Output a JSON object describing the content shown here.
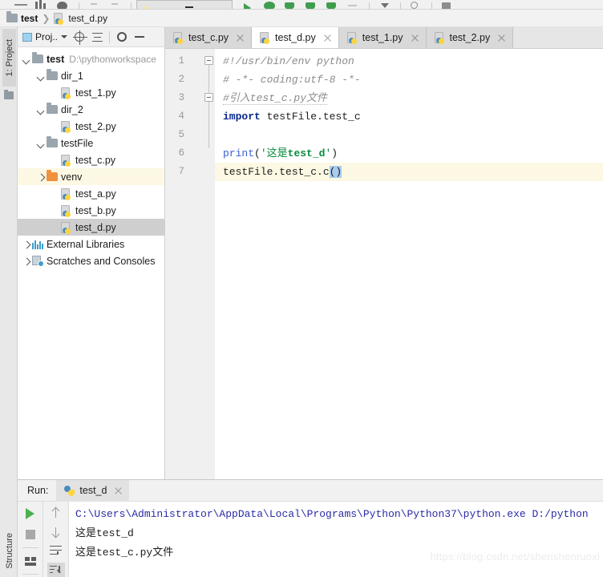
{
  "window": {
    "breadcrumb": {
      "project": "test",
      "file": "test_d.py"
    }
  },
  "toolbar": {
    "run_config": "",
    "icons": [
      "menu-icon",
      "chart-icon",
      "globe-icon",
      "back-icon",
      "forward-icon",
      "run-config-box",
      "run-icon",
      "debug-icon",
      "coverage-icon",
      "profile-icon",
      "attach-icon",
      "stop-icon",
      "dropdown-icon",
      "search-icon",
      "save-icon"
    ]
  },
  "left_strip": {
    "project_tab": "1: Project",
    "structure_tab": "Structure"
  },
  "project_panel": {
    "title": "Proj..",
    "buttons": [
      "locate-icon",
      "collapse-all-icon",
      "settings-icon",
      "hide-icon"
    ],
    "tree": [
      {
        "indent": 0,
        "arrow": "down",
        "icon": "folder",
        "label": "test",
        "bold": true,
        "path": "D:\\pythonworkspace",
        "state": ""
      },
      {
        "indent": 1,
        "arrow": "down",
        "icon": "folder",
        "label": "dir_1",
        "bold": false,
        "path": "",
        "state": ""
      },
      {
        "indent": 2,
        "arrow": "none",
        "icon": "python",
        "label": "test_1.py",
        "bold": false,
        "path": "",
        "state": ""
      },
      {
        "indent": 1,
        "arrow": "down",
        "icon": "folder",
        "label": "dir_2",
        "bold": false,
        "path": "",
        "state": ""
      },
      {
        "indent": 2,
        "arrow": "none",
        "icon": "python",
        "label": "test_2.py",
        "bold": false,
        "path": "",
        "state": ""
      },
      {
        "indent": 1,
        "arrow": "down",
        "icon": "folder",
        "label": "testFile",
        "bold": false,
        "path": "",
        "state": ""
      },
      {
        "indent": 2,
        "arrow": "none",
        "icon": "python",
        "label": "test_c.py",
        "bold": false,
        "path": "",
        "state": ""
      },
      {
        "indent": 1,
        "arrow": "right",
        "icon": "folder-orange",
        "label": "venv",
        "bold": false,
        "path": "",
        "state": "highlight"
      },
      {
        "indent": 2,
        "arrow": "none",
        "icon": "python",
        "label": "test_a.py",
        "bold": false,
        "path": "",
        "state": ""
      },
      {
        "indent": 2,
        "arrow": "none",
        "icon": "python",
        "label": "test_b.py",
        "bold": false,
        "path": "",
        "state": ""
      },
      {
        "indent": 2,
        "arrow": "none",
        "icon": "python",
        "label": "test_d.py",
        "bold": false,
        "path": "",
        "state": "selected"
      },
      {
        "indent": 0,
        "arrow": "right",
        "icon": "library",
        "label": "External Libraries",
        "bold": false,
        "path": "",
        "state": ""
      },
      {
        "indent": 0,
        "arrow": "right",
        "icon": "scratch",
        "label": "Scratches and Consoles",
        "bold": false,
        "path": "",
        "state": ""
      }
    ]
  },
  "editor": {
    "tabs": [
      {
        "label": "test_c.py",
        "active": false
      },
      {
        "label": "test_d.py",
        "active": true
      },
      {
        "label": "test_1.py",
        "active": false
      },
      {
        "label": "test_2.py",
        "active": false
      }
    ],
    "line_numbers": [
      "1",
      "2",
      "3",
      "4",
      "5",
      "6",
      "7"
    ],
    "lines": [
      {
        "n": 1,
        "tokens": [
          {
            "t": "comment",
            "v": "#!/usr/bin/env python"
          }
        ]
      },
      {
        "n": 2,
        "tokens": [
          {
            "t": "comment",
            "v": "# -*- coding:utf-8 -*-"
          }
        ]
      },
      {
        "n": 3,
        "tokens": [
          {
            "t": "comment-squiggle",
            "v": "#引入test_c.py文件"
          }
        ]
      },
      {
        "n": 4,
        "tokens": [
          {
            "t": "keyword",
            "v": "import"
          },
          {
            "t": "plain",
            "v": " testFile.test_c"
          }
        ]
      },
      {
        "n": 5,
        "tokens": []
      },
      {
        "n": 6,
        "tokens": [
          {
            "t": "function",
            "v": "print"
          },
          {
            "t": "plain",
            "v": "("
          },
          {
            "t": "string",
            "v": "'这是test_d'"
          },
          {
            "t": "plain",
            "v": ")"
          }
        ]
      },
      {
        "n": 7,
        "tokens": [
          {
            "t": "plain",
            "v": "testFile.test_c.c"
          },
          {
            "t": "selection",
            "v": "()"
          }
        ],
        "caret_line": true
      }
    ]
  },
  "run_panel": {
    "label": "Run:",
    "tab": "test_d",
    "tools": [
      "rerun-icon",
      "stop-icon",
      "layout-icon",
      "scroll-up-icon",
      "scroll-down-icon",
      "soft-wrap-icon",
      "scroll-to-end-icon"
    ],
    "console": [
      {
        "type": "cmd",
        "text": "C:\\Users\\Administrator\\AppData\\Local\\Programs\\Python\\Python37\\python.exe D:/python"
      },
      {
        "type": "out",
        "text": "这是test_d"
      },
      {
        "type": "out",
        "text": "这是test_c.py文件"
      }
    ],
    "watermark": "https://blog.csdn.net/shenshenruoxi"
  }
}
